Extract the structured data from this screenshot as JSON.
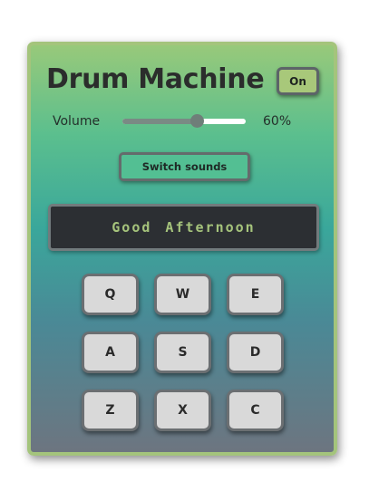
{
  "app": {
    "title": "Drum Machine",
    "power_label": "On"
  },
  "volume": {
    "label": "Volume",
    "percent": 60,
    "value_text": "60%"
  },
  "switch_label": "Switch sounds",
  "display_text": "Good Afternoon",
  "pads": [
    {
      "key": "Q"
    },
    {
      "key": "W"
    },
    {
      "key": "E"
    },
    {
      "key": "A"
    },
    {
      "key": "S"
    },
    {
      "key": "D"
    },
    {
      "key": "Z"
    },
    {
      "key": "X"
    },
    {
      "key": "C"
    }
  ],
  "colors": {
    "accent": "#a8c87a",
    "display_bg": "#2c2f33",
    "display_text": "#a6c47c",
    "pad_bg": "#d9d9d9",
    "switch_bg": "#53bf93"
  }
}
